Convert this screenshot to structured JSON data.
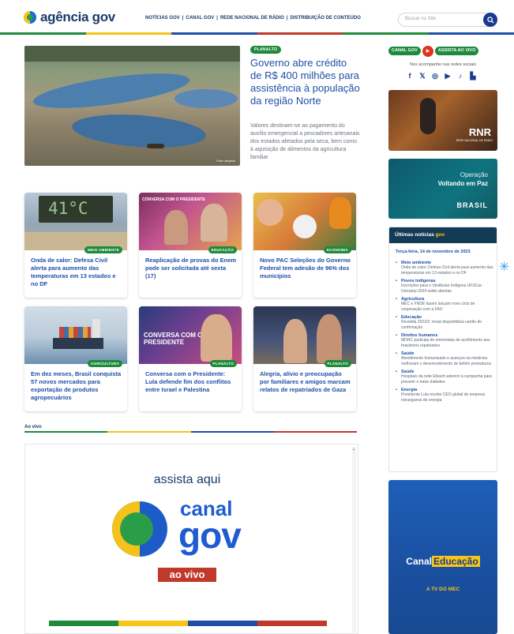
{
  "brand": {
    "name": "agência gov"
  },
  "nav": {
    "items": [
      "NOTÍCIAS GOV",
      "CANAL GOV",
      "REDE NACIONAL DE RÁDIO",
      "DISTRIBUIÇÃO DE CONTEÚDO"
    ],
    "separator": "|"
  },
  "search": {
    "placeholder": "Buscar no Site"
  },
  "colors": {
    "blue": "#1e4fa8",
    "navy": "#1a3a6b",
    "green": "#1f8a3b",
    "yellow": "#f5c518",
    "red": "#c0392b"
  },
  "feature": {
    "badge": "PLANALTO",
    "title": "Governo abre crédito de R$ 400 milhões para assistência à população da região Norte",
    "summary": "Valores destinam-se ao pagamento do auxílio emergencial a pescadores artesanais dos estados afetados pela seca, bem como à aquisição de alimentos da agricultura familiar",
    "credit": "Foto: Arquivo"
  },
  "cards": [
    {
      "badge": "MEIO AMBIENTE",
      "title": "Onda de calor: Defesa Civil alerta para aumento das temperaturas em 13 estados e no DF",
      "image_text": "41°C"
    },
    {
      "badge": "EDUCAÇÃO",
      "title": "Reaplicação de provas do Enem pode ser solicitada até sexta (17)",
      "image_text": "CONVERSA COM O PRESIDENTE"
    },
    {
      "badge": "ECONOMIA",
      "title": "Novo PAC Seleções do Governo Federal tem adesão de 96% dos municípios"
    },
    {
      "badge": "AGRICULTURA",
      "title": "Em dez meses, Brasil conquista 57 novos mercados para exportação de produtos agropecuários"
    },
    {
      "badge": "PLANALTO",
      "title": "Conversa com o Presidente: Lula defende fim dos conflitos entre Israel e Palestina",
      "image_text": "CONVERSA COM O PRESIDENTE"
    },
    {
      "badge": "PLANALTO",
      "title": "Alegria, alívio e preocupação por familiares e amigos marcam relatos de repatriados de Gaza"
    }
  ],
  "live": {
    "section_label": "Ao vivo",
    "assista": "assista aqui",
    "canal": "canal",
    "gov": "gov",
    "ao_vivo": "ao vivo"
  },
  "sidebar": {
    "canal_gov": "CANAL GOV",
    "assista_ao_vivo": "ASSISTA AO VIVO",
    "follow": "Nos acompanhe nas redes sociais",
    "social_icons": [
      "facebook-icon",
      "twitter-icon",
      "instagram-icon",
      "youtube-icon",
      "tiktok-icon",
      "kwai-icon"
    ],
    "social_glyphs": [
      "f",
      "𝕏",
      "◎",
      "▶",
      "♪",
      "▙"
    ],
    "rnr": {
      "logo": "RNR",
      "sub": "REDE NACIONAL DE RÁDIO"
    },
    "operacao": {
      "line1": "Operação",
      "line2": "Voltando em Paz",
      "brasil": "BRASIL"
    },
    "news": {
      "title": "Últimas notícias",
      "title_accent": "gov",
      "date": "Terça-feira, 14 de novembro de 2023",
      "items": [
        {
          "cat": "Meio ambiente",
          "text": "Onda de calor: Defesa Civil alerta para aumento das temperaturas em 13 estados e no DF"
        },
        {
          "cat": "Povos indígenas",
          "text": "Inscrições para o Vestibular Indígena UFSCar-Unicamp 2024 estão abertas"
        },
        {
          "cat": "Agricultura",
          "text": "MEC e FNDE fazem lançam novo ciclo de cooperação com a FAO"
        },
        {
          "cat": "Educação",
          "text": "Revalida 2023/2: mesp disponibiliza cartão de confirmação"
        },
        {
          "cat": "Direitos humanos",
          "text": "MDHC participa de entrevistas de acolhimento aos brasileiros repatriados"
        },
        {
          "cat": "Saúde",
          "text": "Atendimento humanizado e avanços na medicina melhoram o desenvolvimento de bebês prematuros"
        },
        {
          "cat": "Saúde",
          "text": "Hospitais da rede Ebserh aderem à campanha para prevenir e tratar diabetes"
        },
        {
          "cat": "Energia",
          "text": "Presidente Lula recebe CEO global de empresa norueguesa de energia"
        }
      ]
    },
    "edu": {
      "prefix": "Canal",
      "accent": "Educação",
      "sub": "A TV DO MEC"
    }
  }
}
